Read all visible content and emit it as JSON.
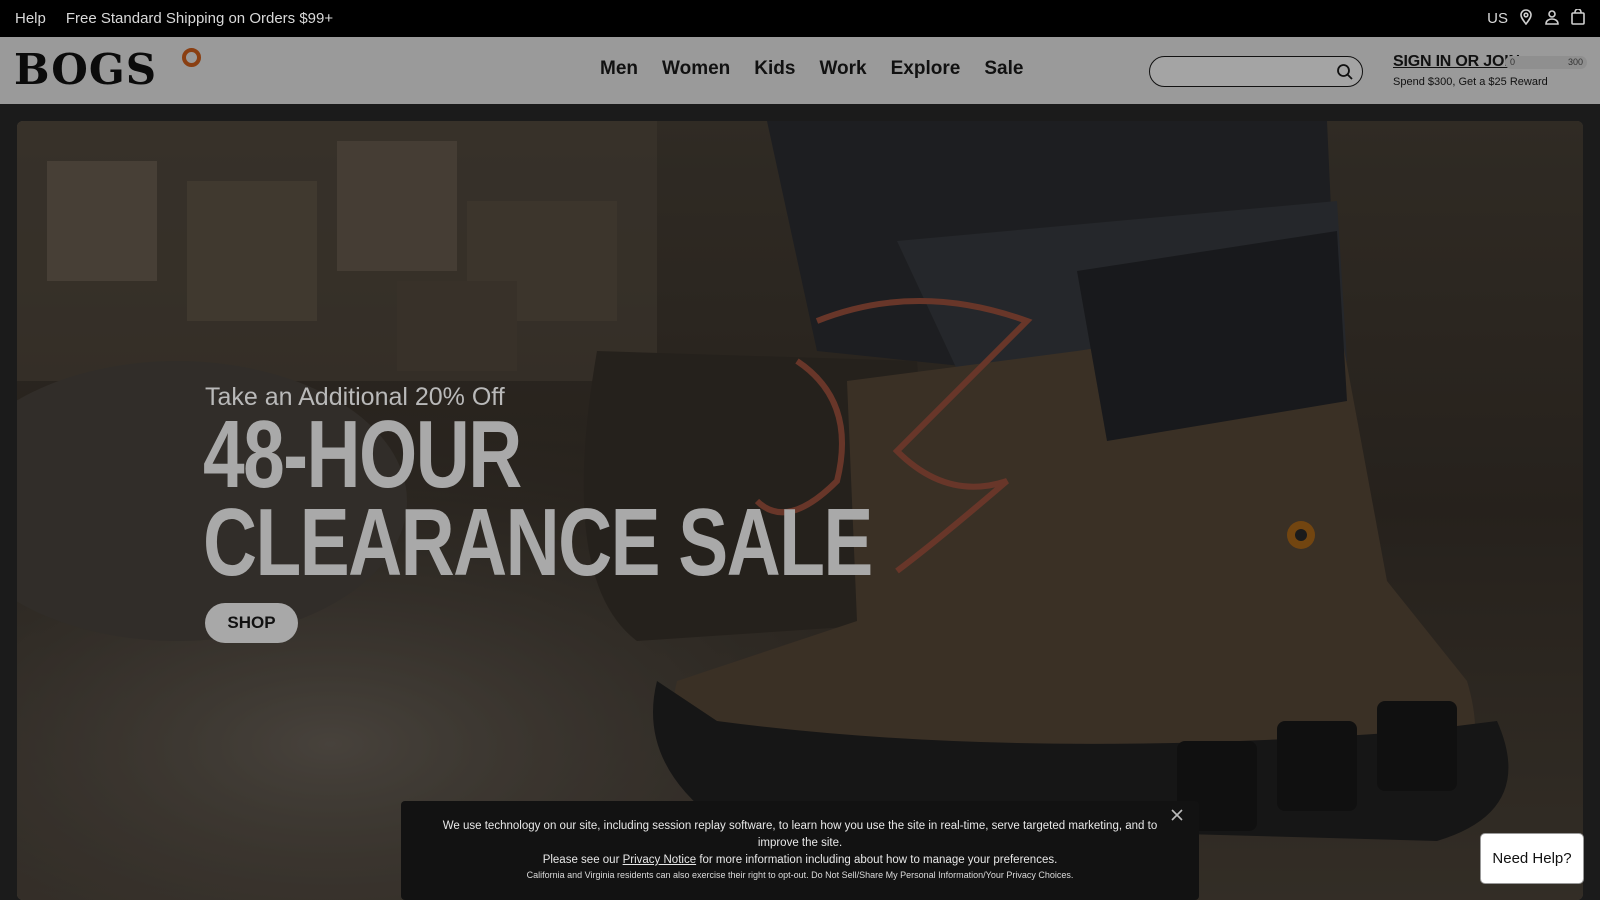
{
  "topbar": {
    "help": "Help",
    "shipping": "Free Standard Shipping on Orders $99+",
    "region": "US"
  },
  "header": {
    "logo": "BOGS",
    "nav": [
      "Men",
      "Women",
      "Kids",
      "Work",
      "Explore",
      "Sale"
    ],
    "search_placeholder": "",
    "signin": "SIGN IN OR JOIN",
    "reward_min": "0",
    "reward_max": "300",
    "reward_text": "Spend $300, Get a $25 Reward"
  },
  "hero": {
    "kicker": "Take an Additional 20% Off",
    "headline_line1": "48-HOUR",
    "headline_line2": "CLEARANCE SALE",
    "cta": "SHOP"
  },
  "cookie": {
    "line1": "We use technology on our site, including session replay software, to learn how you use the site in real-time, serve targeted marketing, and to improve the site.",
    "line2_before": "Please see our",
    "privacy_link": "Privacy Notice",
    "line2_after": "for more information including about how to manage your preferences.",
    "line3": "California and Virginia residents can also exercise their right to opt-out. Do Not Sell/Share My Personal Information/Your Privacy Choices."
  },
  "help_button": "Need Help?",
  "colors": {
    "accent_logo_dot": "#8a3f12",
    "overlay": "rgba(0,0,0,0.55)"
  }
}
